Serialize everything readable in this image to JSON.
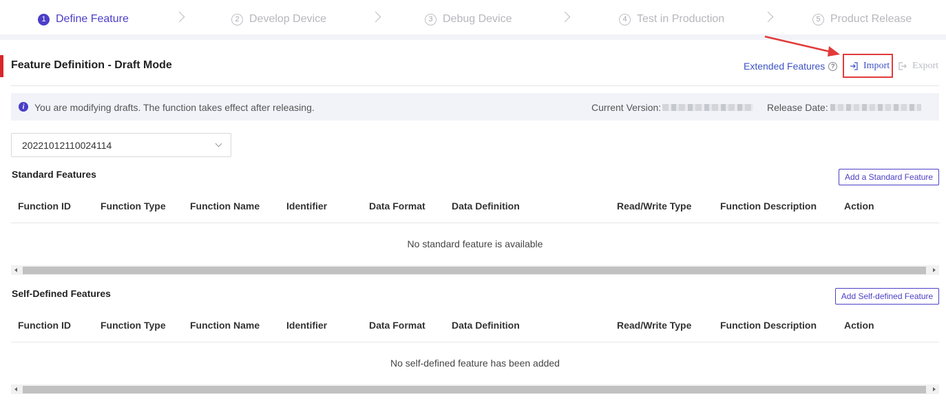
{
  "stepper": {
    "steps": [
      {
        "num": "1",
        "label": "Define Feature"
      },
      {
        "num": "2",
        "label": "Develop Device"
      },
      {
        "num": "3",
        "label": "Debug Device"
      },
      {
        "num": "4",
        "label": "Test in Production"
      },
      {
        "num": "5",
        "label": "Product Release"
      }
    ],
    "active_index": 0
  },
  "header": {
    "title": "Feature Definition - Draft Mode",
    "extended_features": "Extended Features",
    "help_icon": "?",
    "import_label": "Import",
    "export_label": "Export"
  },
  "info_bar": {
    "icon": "i",
    "message": "You are modifying drafts. The function takes effect after releasing.",
    "current_version_label": "Current Version:",
    "release_date_label": "Release Date:"
  },
  "version_select": {
    "value": "20221012110024114"
  },
  "table_columns": [
    "Function ID",
    "Function Type",
    "Function Name",
    "Identifier",
    "Data Format",
    "Data Definition",
    "Read/Write Type",
    "Function Description",
    "Action"
  ],
  "standard": {
    "title": "Standard Features",
    "add_button": "Add a Standard Feature",
    "empty_message": "No standard feature is available"
  },
  "custom": {
    "title": "Self-Defined Features",
    "add_button": "Add Self-defined Feature",
    "empty_message": "No self-defined feature has been added"
  },
  "colors": {
    "accent": "#4b3fc7",
    "link": "#3d52c4",
    "highlight": "#e23a3a",
    "title_bar": "#d9262c"
  }
}
